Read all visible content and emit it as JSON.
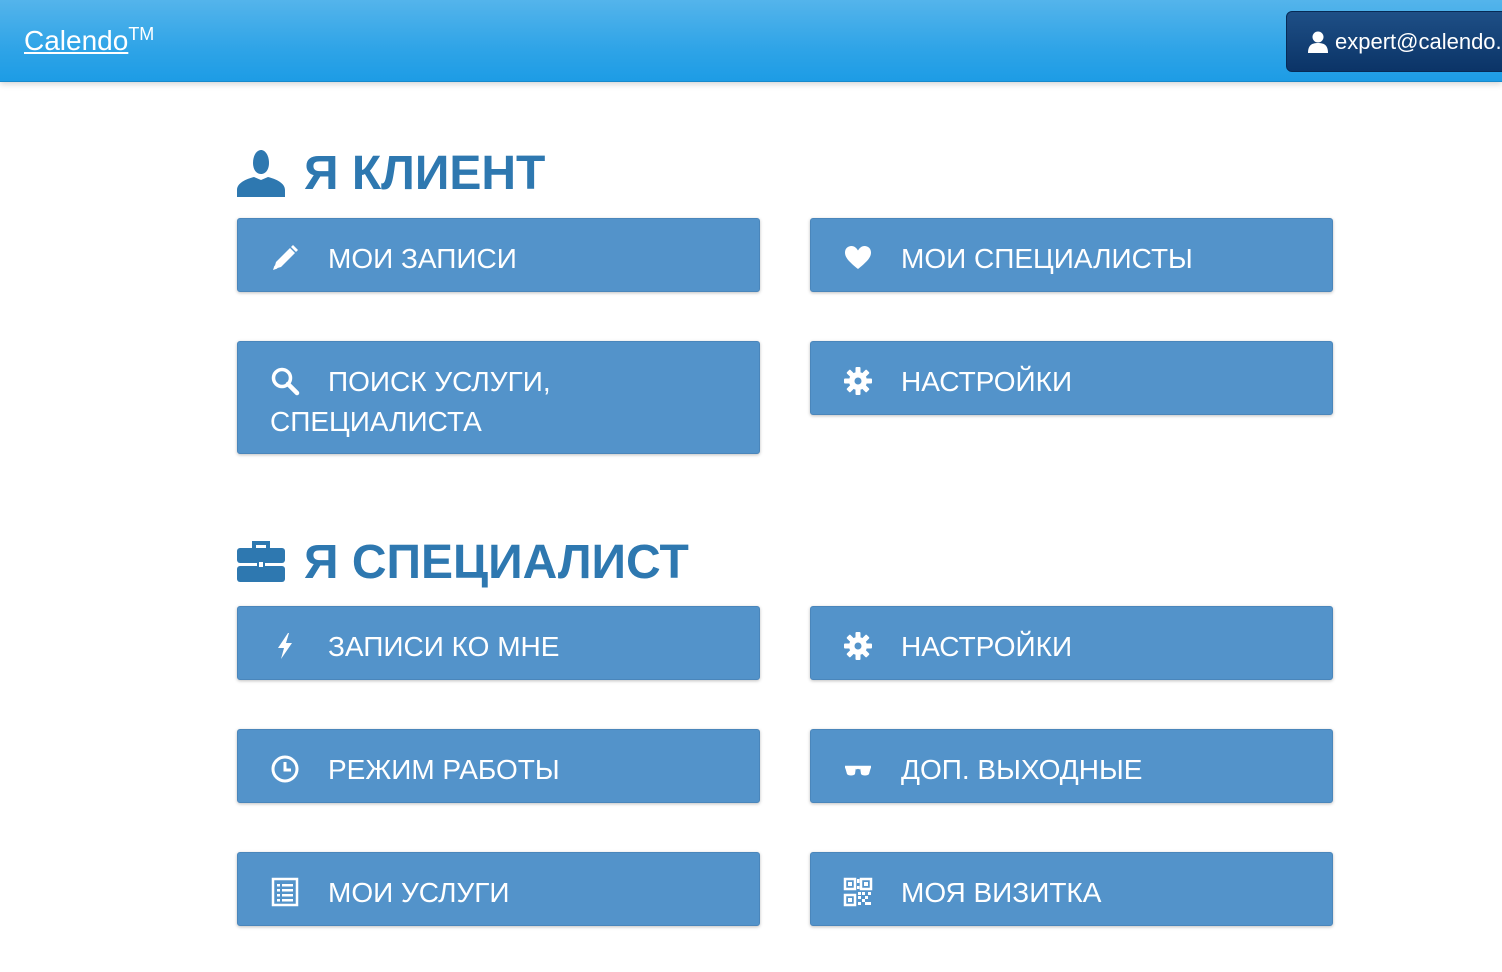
{
  "navbar": {
    "brand": "Calendo",
    "trademark": "TM",
    "user_email": "expert@calendo.ru"
  },
  "client_section": {
    "title": "Я КЛИЕНТ",
    "icon": "user-icon",
    "tiles": [
      {
        "label": "МОИ ЗАПИСИ",
        "icon": "pencil-icon"
      },
      {
        "label": "МОИ СПЕЦИАЛИСТЫ",
        "icon": "heart-icon"
      },
      {
        "label": "ПОИСК УСЛУГИ, СПЕЦИАЛИСТА",
        "icon": "search-icon"
      },
      {
        "label": "НАСТРОЙКИ",
        "icon": "gear-icon"
      }
    ]
  },
  "specialist_section": {
    "title": "Я СПЕЦИАЛИСТ",
    "icon": "briefcase-icon",
    "tiles": [
      {
        "label": "ЗАПИСИ КО МНЕ",
        "icon": "lightning-icon"
      },
      {
        "label": "НАСТРОЙКИ",
        "icon": "gear-icon"
      },
      {
        "label": "РЕЖИМ РАБОТЫ",
        "icon": "clock-icon"
      },
      {
        "label": "ДОП. ВЫХОДНЫЕ",
        "icon": "sunglasses-icon"
      },
      {
        "label": "МОИ УСЛУГИ",
        "icon": "list-icon"
      },
      {
        "label": "МОЯ ВИЗИТКА",
        "icon": "qrcode-icon"
      }
    ]
  },
  "colors": {
    "navbar": "#2fa4e7",
    "user_button": "#0b3467",
    "tile": "#5393ca",
    "section_title": "#2e78b0"
  }
}
